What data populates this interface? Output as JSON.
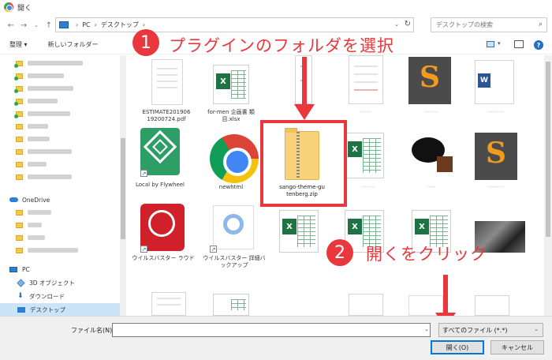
{
  "window": {
    "title": "開く"
  },
  "address": {
    "crumbs": [
      "PC",
      "デスクトップ"
    ],
    "search_placeholder": "デスクトップの検索"
  },
  "toolbar": {
    "organize": "整理 ▾",
    "new_folder": "新しいフォルダー"
  },
  "sidebar": {
    "onedrive": "OneDrive",
    "pc": "PC",
    "objects3d": "3D オブジェクト",
    "downloads": "ダウンロード",
    "desktop": "デスクトップ"
  },
  "files": {
    "estimate": "ESTIMATE201906 19200724.pdf",
    "formen": "for-men 企画書 類目.xlsx",
    "local": "Local by Flywheel",
    "newhtml": "newhtml",
    "zip": "sango-theme-gu tenberg.zip",
    "trend1": "ウイルスバスター ラウド",
    "trend2": "ウイルスバスター 詳細バックアップ"
  },
  "annotations": {
    "step1_num": "1",
    "step1_text": "プラグインのフォルダを選択",
    "step2_num": "2",
    "step2_text": "開くをクリック",
    "color": "#e8383d"
  },
  "bottom": {
    "filename_label": "ファイル名(N):",
    "filename_value": "",
    "filetype": "すべてのファイル (*.*)",
    "open_button": "開く(O)",
    "cancel_button": "キャンセル"
  }
}
